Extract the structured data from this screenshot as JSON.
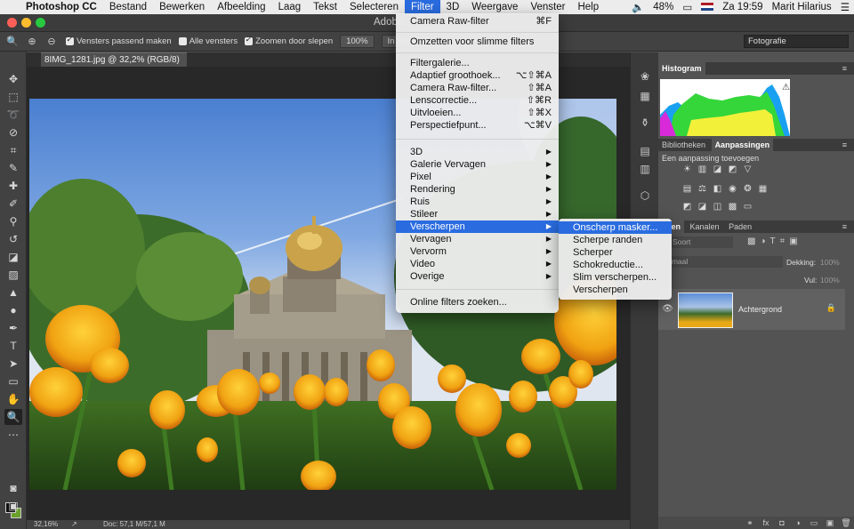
{
  "menubar": {
    "app_name": "Photoshop CC",
    "items": [
      "Bestand",
      "Bewerken",
      "Afbeelding",
      "Laag",
      "Tekst",
      "Selecteren",
      "Filter",
      "3D",
      "Weergave",
      "Venster",
      "Help"
    ],
    "battery": "48%",
    "clock": "Za 19:59",
    "user": "Marit Hilarius"
  },
  "window": {
    "title": "Adobe"
  },
  "options_bar": {
    "check1": "Vensters passend maken",
    "check2": "Alle vensters",
    "check3": "Zoomen door slepen",
    "zoom_value": "100%",
    "fit_button": "In venster",
    "workspace": "Fotografie"
  },
  "document": {
    "tab_label": "8IMG_1281.jpg @ 32,2% (RGB/8)"
  },
  "status": {
    "zoom": "32,16%",
    "doc_size": "Doc: 57,1 M/57,1 M"
  },
  "panels": {
    "histogram": "Histogram",
    "tab_libraries": "Bibliotheken",
    "tab_adjustments": "Aanpassingen",
    "adjust_title": "Een aanpassing toevoegen",
    "tab_layers": "agen",
    "tab_channels": "Kanalen",
    "tab_paths": "Paden",
    "search_kind": "Soort",
    "blend_mode": "rmaal",
    "opacity_label": "Dekking:",
    "opacity_value": "100%",
    "fill_label": "Vul:",
    "fill_value": "100%",
    "layer_name": "Achtergrond"
  },
  "filter_menu": {
    "last_filter": "Camera Raw-filter",
    "last_filter_shortcut": "⌘F",
    "convert": "Omzetten voor slimme filters",
    "gallery": "Filtergalerie...",
    "wide_angle": "Adaptief groothoek...",
    "wide_angle_shortcut": "⌥⇧⌘A",
    "camera_raw": "Camera Raw-filter...",
    "camera_raw_shortcut": "⇧⌘A",
    "lens": "Lenscorrectie...",
    "lens_shortcut": "⇧⌘R",
    "liquify": "Uitvloeien...",
    "liquify_shortcut": "⇧⌘X",
    "perspective": "Perspectiefpunt...",
    "perspective_shortcut": "⌥⌘V",
    "submenus": [
      "3D",
      "Galerie Vervagen",
      "Pixel",
      "Rendering",
      "Ruis",
      "Stileer",
      "Verscherpen",
      "Vervagen",
      "Vervorm",
      "Video",
      "Overige"
    ],
    "online": "Online filters zoeken..."
  },
  "sharpen_submenu": [
    "Onscherp masker...",
    "Scherpe randen",
    "Scherper",
    "Schokreductie...",
    "Slim verscherpen...",
    "Verscherpen"
  ],
  "colors": {
    "menu_highlight": "#2a6ce0",
    "background_swatch": "#6ba02d"
  }
}
